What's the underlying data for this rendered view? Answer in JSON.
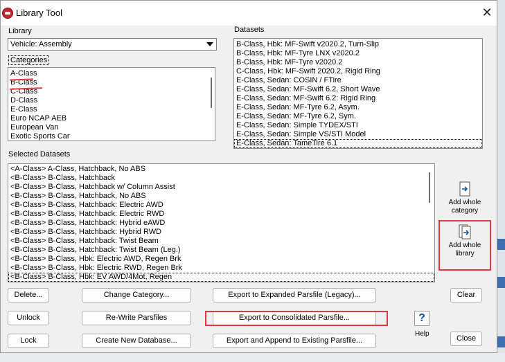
{
  "window": {
    "title": "Library Tool",
    "close_glyph": "✕"
  },
  "library": {
    "label": "Library",
    "selected": "Vehicle: Assembly"
  },
  "categories": {
    "label": "Categories",
    "items": [
      "A-Class",
      "B-Class",
      "C-Class",
      "D-Class",
      "E-Class",
      "Euro NCAP AEB",
      "European Van",
      "Exotic Sports Car"
    ]
  },
  "datasets": {
    "label": "Datasets",
    "items": [
      "B-Class, Hbk: MF-Swift v2020.2, Turn-Slip",
      "B-Class, Hbk: MF-Tyre LNX v2020.2",
      "B-Class, Hbk: MF-Tyre v2020.2",
      "C-Class, Hbk: MF-Swift 2020.2, Rigid Ring",
      "E-Class, Sedan: COSIN / FTire",
      "E-Class, Sedan: MF-Swift 6.2, Short Wave",
      "E-Class, Sedan: MF-Swift 6.2: Rigid Ring",
      "E-Class, Sedan: MF-Tyre 6.2, Asym.",
      "E-Class, Sedan: MF-Tyre 6.2, Sym.",
      "E-Class, Sedan: Simple TYDEX/STI",
      "E-Class, Sedan: Simple VS/STI Model",
      "E-Class, Sedan: TameTire 6.1"
    ]
  },
  "selected_datasets": {
    "label": "Selected Datasets",
    "items": [
      "<A-Class> A-Class, Hatchback, No ABS",
      "<B-Class> B-Class, Hatchback",
      "<B-Class> B-Class, Hatchback w/ Column Assist",
      "<B-Class> B-Class, Hatchback, No ABS",
      "<B-Class> B-Class, Hatchback: Electric AWD",
      "<B-Class> B-Class, Hatchback: Electric RWD",
      "<B-Class> B-Class, Hatchback: Hybrid eAWD",
      "<B-Class> B-Class, Hatchback: Hybrid RWD",
      "<B-Class> B-Class, Hatchback: Twist Beam",
      "<B-Class> B-Class, Hatchback: Twist Beam (Leg.)",
      "<B-Class> B-Class, Hbk: Electric AWD, Regen Brk",
      "<B-Class> B-Class, Hbk: Electric RWD, Regen Brk",
      "<B-Class> B-Class, Hbk: EV AWD/4Mot, Regen"
    ]
  },
  "side": {
    "add_category_line1": "Add whole",
    "add_category_line2": "category",
    "add_library_line1": "Add whole",
    "add_library_line2": "library",
    "help_glyph": "?",
    "help_label": "Help"
  },
  "buttons": {
    "delete": "Delete...",
    "change_category": "Change Category...",
    "export_expanded": "Export to Expanded Parsfile (Legacy)...",
    "clear": "Clear",
    "unlock": "Unlock",
    "rewrite": "Re-Write Parsfiles",
    "export_consolidated": "Export to Consolidated Parsfile...",
    "lock": "Lock",
    "create_db": "Create New Database...",
    "export_append": "Export and Append to Existing Parsfile...",
    "close": "Close"
  },
  "colors": {
    "annotation": "#e0383f",
    "window_bg": "#f0f0f0"
  }
}
